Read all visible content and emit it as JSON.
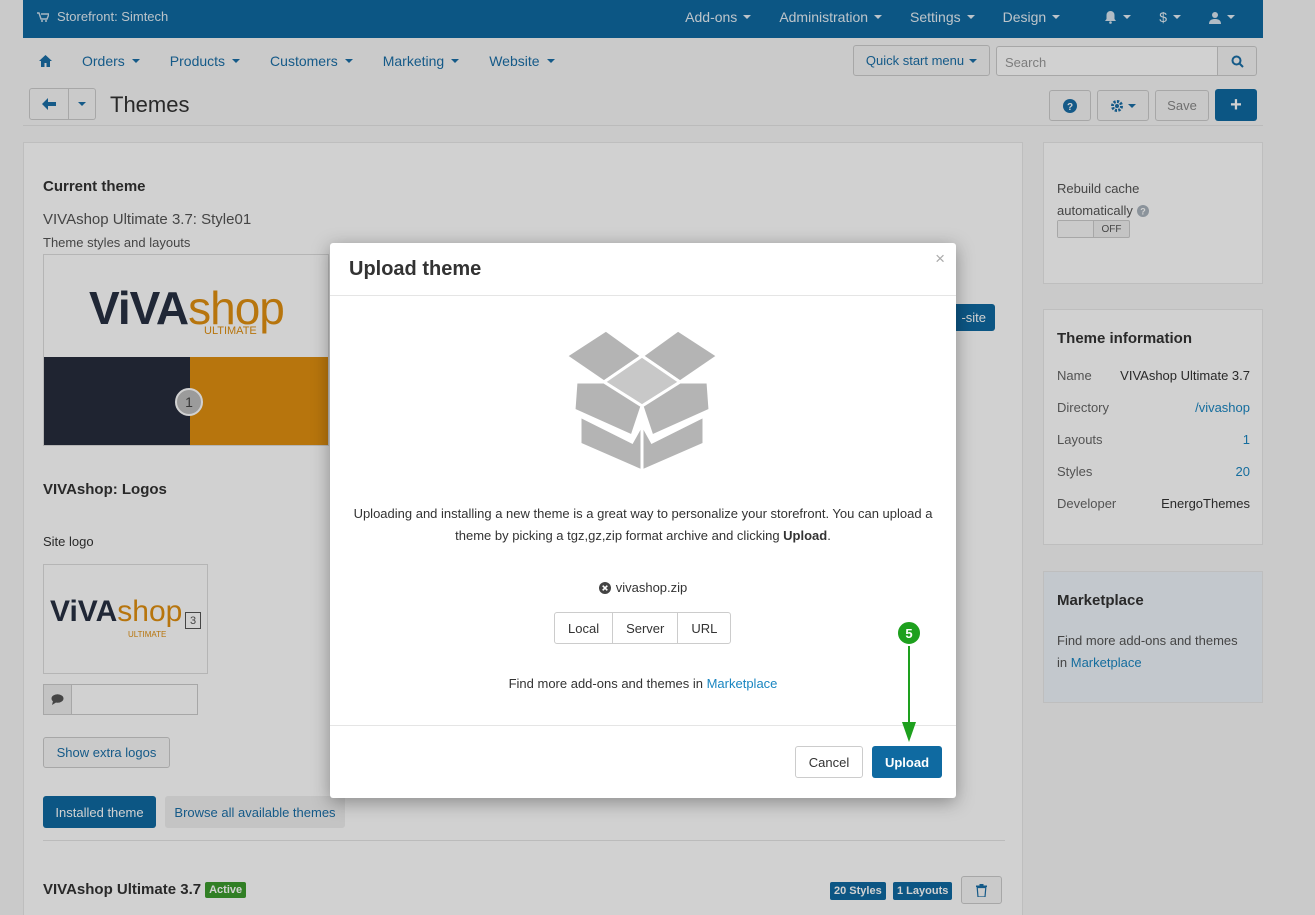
{
  "topbar": {
    "store": "Storefront: Simtech",
    "menu": [
      "Add-ons",
      "Administration",
      "Settings",
      "Design"
    ],
    "currency": "$"
  },
  "nav": {
    "items": [
      "Orders",
      "Products",
      "Customers",
      "Marketing",
      "Website"
    ],
    "quick_start": "Quick start menu",
    "search_placeholder": "Search"
  },
  "titlebar": {
    "title": "Themes",
    "save": "Save"
  },
  "main": {
    "current_theme_heading": "Current theme",
    "current_theme_name": "VIVAshop Ultimate 3.7: Style01",
    "styles_layouts": "Theme styles and layouts",
    "preview_number": "1",
    "preview_button_suffix": "-site",
    "logos_heading": "VIVAshop: Logos",
    "site_logo_label": "Site logo",
    "logo_text_viva": "ViVA",
    "logo_text_shop": "shop",
    "logo_text_ultimate": "ULTIMATE",
    "logo_text_version": "3",
    "show_extra_logos": "Show extra logos",
    "tab_installed": "Installed theme",
    "tab_browse": "Browse all available themes",
    "installed_name": "VIVAshop Ultimate 3.7",
    "active_badge": "Active",
    "styles_badge": "20 Styles",
    "layouts_badge": "1 Layouts"
  },
  "sidebar": {
    "rebuild_label_1": "Rebuild cache",
    "rebuild_label_2": "automatically",
    "toggle_state": "OFF",
    "info_heading": "Theme information",
    "info": [
      {
        "key": "Name",
        "value": "VIVAshop Ultimate 3.7"
      },
      {
        "key": "Directory",
        "value": "/vivashop"
      },
      {
        "key": "Layouts",
        "value": "1"
      },
      {
        "key": "Styles",
        "value": "20"
      },
      {
        "key": "Developer",
        "value": "EnergoThemes"
      }
    ],
    "marketplace_heading": "Marketplace",
    "marketplace_text": "Find more add-ons and themes in",
    "marketplace_link": "Marketplace"
  },
  "modal": {
    "title": "Upload theme",
    "close": "×",
    "desc_part1": "Uploading and installing a new theme is a great way to personalize your storefront. You can upload a theme by picking a tgz,gz,zip format archive and clicking ",
    "desc_bold": "Upload",
    "desc_end": ".",
    "filename": "vivashop.zip",
    "sources": [
      "Local",
      "Server",
      "URL"
    ],
    "find_text": "Find more add-ons and themes in ",
    "find_link": "Marketplace",
    "cancel": "Cancel",
    "upload": "Upload",
    "step_number": "5"
  },
  "colors": {
    "primary": "#0f6aa1",
    "link": "#1a6ea7",
    "active_green": "#3c9c2e",
    "step_green": "#1ea01e"
  }
}
